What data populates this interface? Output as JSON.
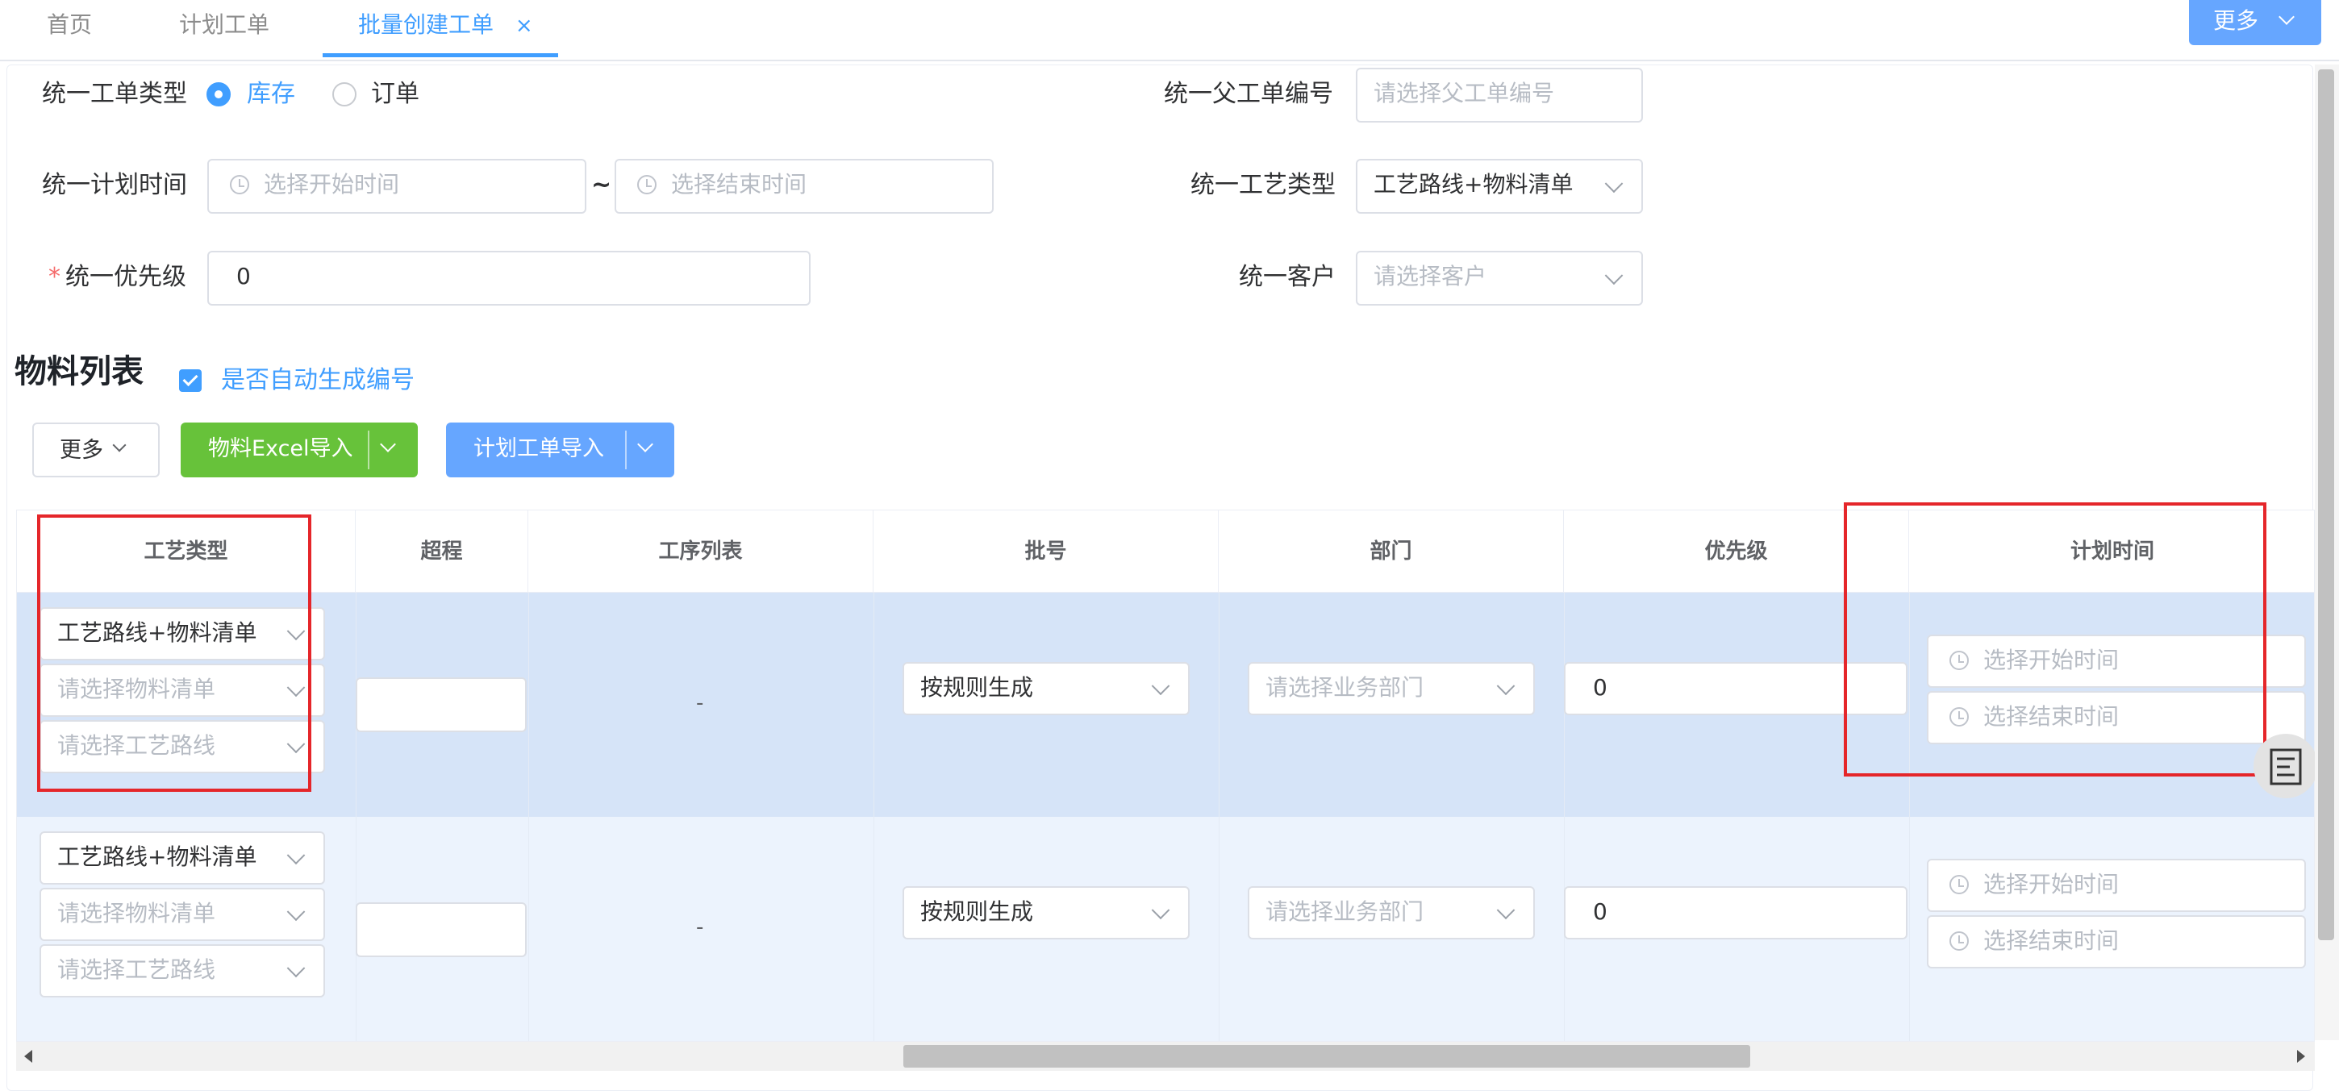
{
  "tabs": [
    {
      "label": "首页"
    },
    {
      "label": "计划工单"
    },
    {
      "label": "批量创建工单",
      "close": "×"
    }
  ],
  "top_more": "更多",
  "form": {
    "type_label": "统一工单类型",
    "type_options": [
      "库存",
      "订单"
    ],
    "time_label": "统一计划时间",
    "start_ph": "选择开始时间",
    "tilde": "~",
    "end_ph": "选择结束时间",
    "priority_required": "*",
    "priority_label": "统一优先级",
    "priority_value": "0",
    "parent_label": "统一父工单编号",
    "parent_ph": "请选择父工单编号",
    "craft_label": "统一工艺类型",
    "craft_value": "工艺路线+物料清单",
    "customer_label": "统一客户",
    "customer_ph": "请选择客户"
  },
  "materials": {
    "title": "物料列表",
    "auto_label": "是否自动生成编号",
    "buttons": {
      "more": "更多",
      "excel": "物料Excel导入",
      "plan_import": "计划工单导入"
    }
  },
  "table": {
    "headers": [
      "工艺类型",
      "超程",
      "工序列表",
      "批号",
      "部门",
      "优先级",
      "计划时间"
    ],
    "rows": [
      {
        "craft": "工艺路线+物料清单",
        "bom_ph": "请选择物料清单",
        "route_ph": "请选择工艺路线",
        "procs": "-",
        "batch": "按规则生成",
        "dept_ph": "请选择业务部门",
        "priority": "0",
        "start_ph": "选择开始时间",
        "end_ph": "选择结束时间"
      },
      {
        "craft": "工艺路线+物料清单",
        "bom_ph": "请选择物料清单",
        "route_ph": "请选择工艺路线",
        "procs": "-",
        "batch": "按规则生成",
        "dept_ph": "请选择业务部门",
        "priority": "0",
        "start_ph": "选择开始时间",
        "end_ph": "选择结束时间"
      }
    ]
  },
  "colors": {
    "primary": "#409eff",
    "success": "#67c23a",
    "highlight": "#e5262a"
  }
}
